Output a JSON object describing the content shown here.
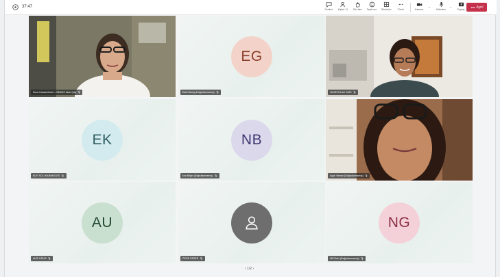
{
  "window": {
    "time": "37:47"
  },
  "toolbar": {
    "chat_label": "Sohbet",
    "people_label": "Kişiler",
    "people_count": "11",
    "raise_label": "Söz iste",
    "react_label": "Tepki ver",
    "view_label": "Görünüm",
    "more_label": "Tümü",
    "camera_label": "Kamera",
    "mic_label": "Mikrofon",
    "share_label": "Paylaş",
    "leave_label": "Ayrıl"
  },
  "participants": [
    {
      "name": "Sunu Karamehmet - GİDAKS İstoc Çdp",
      "initials": "",
      "type": "video",
      "colors": {
        "bg": "#6d6a5a"
      }
    },
    {
      "name": "Eda Güneş (Doğrulanmamış)",
      "initials": "EG",
      "type": "avatar",
      "colors": {
        "bg": "#f3d3c9",
        "fg": "#8a3e28"
      }
    },
    {
      "name": "HUSEYIN ALI SARI",
      "initials": "",
      "type": "video",
      "colors": {
        "bg": "#e9e5df"
      }
    },
    {
      "name": "ELİF SOLI KARAKELES",
      "initials": "EK",
      "type": "avatar",
      "colors": {
        "bg": "#d3ebee",
        "fg": "#2f5e64"
      }
    },
    {
      "name": "Nur Bilgin (Doğrulanmamış)",
      "initials": "NB",
      "type": "avatar",
      "colors": {
        "bg": "#dcd8ec",
        "fg": "#3e3770"
      }
    },
    {
      "name": "Ayşe Yaman (Doğrulanmamış)",
      "initials": "",
      "type": "video",
      "colors": {
        "bg": "#9a6a4a"
      }
    },
    {
      "name": "AKİF UĞUR",
      "initials": "AU",
      "type": "avatar",
      "colors": {
        "bg": "#c9dfcf",
        "fg": "#244a31"
      }
    },
    {
      "name": "ÖZGE SEZER",
      "initials": "",
      "type": "default",
      "colors": {
        "bg": "#6e6e6e",
        "fg": "#ffffff"
      }
    },
    {
      "name": "Nil Gider (Doğrulanmamış)",
      "initials": "NG",
      "type": "avatar",
      "colors": {
        "bg": "#f4d1d8",
        "fg": "#8a2f43"
      }
    }
  ],
  "pager": {
    "label": "1/2"
  },
  "icons": {
    "chat": "chat-icon",
    "people": "people-icon",
    "raise": "raise-hand-icon",
    "react": "react-icon",
    "view": "view-grid-icon",
    "more": "more-icon",
    "camera": "camera-icon",
    "mic": "mic-icon",
    "share": "share-icon",
    "leave": "phone-hangup-icon"
  },
  "accent": "#c4314b"
}
